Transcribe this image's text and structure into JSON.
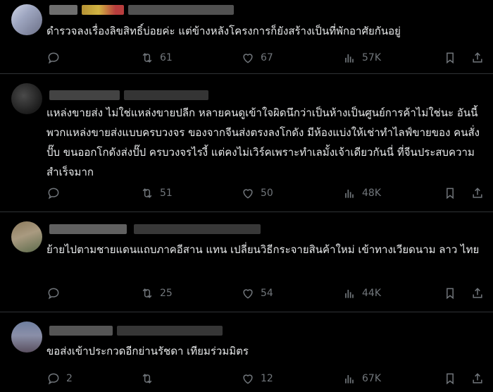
{
  "posts": [
    {
      "text": "ดำรวจลงเรื่องลิขสิทธิ์บ่อยค่ะ แต่ข้างหลังโครงการก็ยังสร้างเป็นที่พักอาศัยกันอยู่",
      "replies": "",
      "reposts": "61",
      "likes": "67",
      "views": "57K"
    },
    {
      "text": "แหล่งขายส่ง ไม่ใช่แหล่งขายปลีก หลายคนดูเข้าใจผิดนึกว่าเป็นห้างเป็นศูนย์การค้าไม่ใช่นะ อันนี้พวกแหล่งขายส่งแบบครบวงจร ของจากจีนส่งตรงลงโกดัง มีห้องแบ่งให้เช่าทำไลฟ์ขายของ คนสั่งปั๊บ ขนออกโกดังส่งปั๊ป ครบวงจรไรงี้ แต่คงไม่เวิร์คเพราะทำเลมั้งเจ้าเดียวกันนี่ ที่จีนประสบความสำเร็จมาก",
      "replies": "",
      "reposts": "51",
      "likes": "50",
      "views": "48K"
    },
    {
      "text": "ย้ายไปตามชายแดนแถบภาคอีสาน แทน เปลี่ยนวิธีกระจายสินค้าใหม่ เข้าทางเวียดนาม ลาว ไทย",
      "replies": "",
      "reposts": "25",
      "likes": "54",
      "views": "44K"
    },
    {
      "text": "ขอส่งเข้าประกวดอีกย่านรัชดา เทียมร่วมมิตร",
      "replies": "2",
      "reposts": "",
      "likes": "12",
      "views": "67K"
    }
  ],
  "colors": {
    "background": "#000000",
    "text": "#e7e9ea",
    "muted": "#71767b",
    "divider": "#2f3336"
  },
  "icons": [
    "reply-icon",
    "repost-icon",
    "like-icon",
    "views-icon",
    "bookmark-icon",
    "share-icon"
  ]
}
